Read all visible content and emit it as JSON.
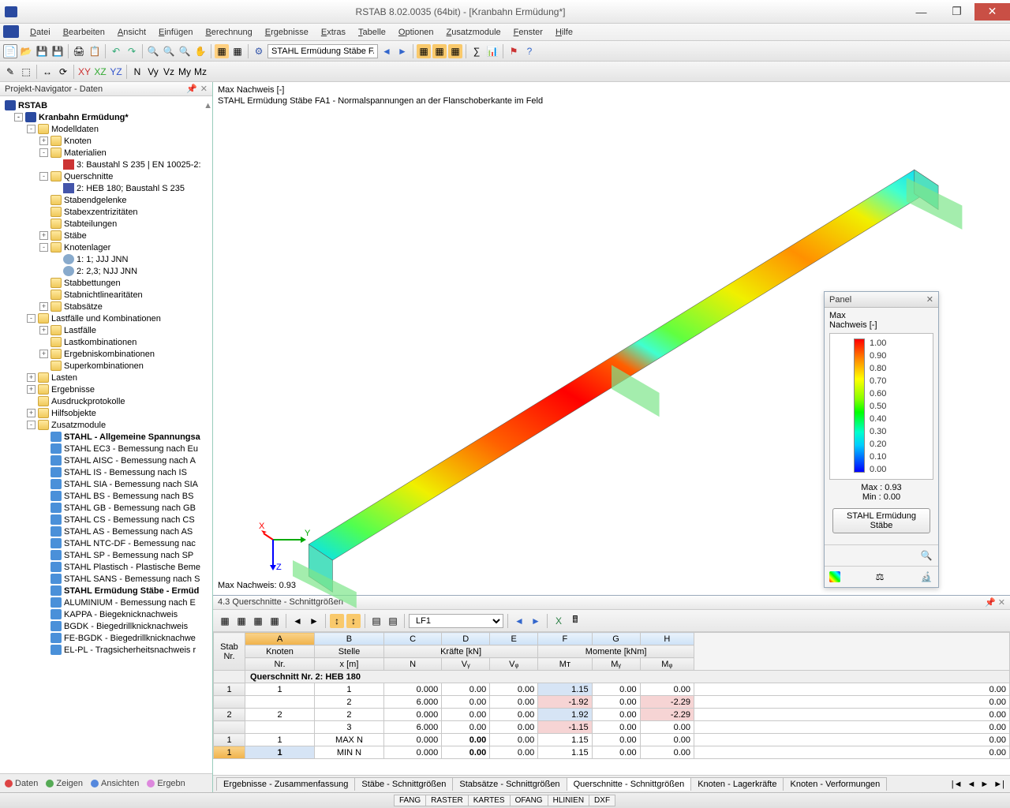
{
  "window": {
    "title": "RSTAB 8.02.0035 (64bit) - [Kranbahn Ermüdung*]",
    "min": "—",
    "max": "❐",
    "close": "✕"
  },
  "menu": [
    "Datei",
    "Bearbeiten",
    "Ansicht",
    "Einfügen",
    "Berechnung",
    "Ergebnisse",
    "Extras",
    "Tabelle",
    "Optionen",
    "Zusatzmodule",
    "Fenster",
    "Hilfe"
  ],
  "toolbar1_input": "STAHL Ermüdung Stäbe FA",
  "navigator": {
    "title": "Projekt-Navigator - Daten",
    "root": "RSTAB",
    "items": [
      {
        "lvl": 1,
        "exp": "-",
        "ico": "rstab",
        "label": "Kranbahn Ermüdung*",
        "bold": true
      },
      {
        "lvl": 2,
        "exp": "-",
        "ico": "folder-open",
        "label": "Modelldaten"
      },
      {
        "lvl": 3,
        "exp": "+",
        "ico": "folder",
        "label": "Knoten"
      },
      {
        "lvl": 3,
        "exp": "-",
        "ico": "folder-open",
        "label": "Materialien"
      },
      {
        "lvl": 4,
        "exp": "",
        "ico": "mat",
        "label": "3: Baustahl S 235 | EN 10025-2:"
      },
      {
        "lvl": 3,
        "exp": "-",
        "ico": "folder-open",
        "label": "Querschnitte"
      },
      {
        "lvl": 4,
        "exp": "",
        "ico": "cross",
        "label": "2: HEB 180; Baustahl S 235"
      },
      {
        "lvl": 3,
        "exp": "",
        "ico": "folder",
        "label": "Stabendgelenke"
      },
      {
        "lvl": 3,
        "exp": "",
        "ico": "folder",
        "label": "Stabexzentrizitäten"
      },
      {
        "lvl": 3,
        "exp": "",
        "ico": "folder",
        "label": "Stabteilungen"
      },
      {
        "lvl": 3,
        "exp": "+",
        "ico": "folder",
        "label": "Stäbe"
      },
      {
        "lvl": 3,
        "exp": "-",
        "ico": "folder-open",
        "label": "Knotenlager"
      },
      {
        "lvl": 4,
        "exp": "",
        "ico": "node",
        "label": "1: 1; JJJ JNN"
      },
      {
        "lvl": 4,
        "exp": "",
        "ico": "node",
        "label": "2: 2,3; NJJ JNN"
      },
      {
        "lvl": 3,
        "exp": "",
        "ico": "folder",
        "label": "Stabbettungen"
      },
      {
        "lvl": 3,
        "exp": "",
        "ico": "folder",
        "label": "Stabnichtlinearitäten"
      },
      {
        "lvl": 3,
        "exp": "+",
        "ico": "folder",
        "label": "Stabsätze"
      },
      {
        "lvl": 2,
        "exp": "-",
        "ico": "folder-open",
        "label": "Lastfälle und Kombinationen"
      },
      {
        "lvl": 3,
        "exp": "+",
        "ico": "folder",
        "label": "Lastfälle"
      },
      {
        "lvl": 3,
        "exp": "",
        "ico": "folder",
        "label": "Lastkombinationen"
      },
      {
        "lvl": 3,
        "exp": "+",
        "ico": "folder",
        "label": "Ergebniskombinationen"
      },
      {
        "lvl": 3,
        "exp": "",
        "ico": "folder",
        "label": "Superkombinationen"
      },
      {
        "lvl": 2,
        "exp": "+",
        "ico": "folder",
        "label": "Lasten"
      },
      {
        "lvl": 2,
        "exp": "+",
        "ico": "folder",
        "label": "Ergebnisse"
      },
      {
        "lvl": 2,
        "exp": "",
        "ico": "folder",
        "label": "Ausdruckprotokolle"
      },
      {
        "lvl": 2,
        "exp": "+",
        "ico": "folder",
        "label": "Hilfsobjekte"
      },
      {
        "lvl": 2,
        "exp": "-",
        "ico": "folder-open",
        "label": "Zusatzmodule"
      },
      {
        "lvl": 3,
        "exp": "",
        "ico": "module",
        "label": "STAHL - Allgemeine Spannungsa",
        "bold": true
      },
      {
        "lvl": 3,
        "exp": "",
        "ico": "module",
        "label": "STAHL EC3 - Bemessung nach Eu"
      },
      {
        "lvl": 3,
        "exp": "",
        "ico": "module",
        "label": "STAHL AISC - Bemessung nach A"
      },
      {
        "lvl": 3,
        "exp": "",
        "ico": "module",
        "label": "STAHL IS - Bemessung nach IS"
      },
      {
        "lvl": 3,
        "exp": "",
        "ico": "module",
        "label": "STAHL SIA - Bemessung nach SIA"
      },
      {
        "lvl": 3,
        "exp": "",
        "ico": "module",
        "label": "STAHL BS - Bemessung nach BS"
      },
      {
        "lvl": 3,
        "exp": "",
        "ico": "module",
        "label": "STAHL GB - Bemessung nach GB"
      },
      {
        "lvl": 3,
        "exp": "",
        "ico": "module",
        "label": "STAHL CS - Bemessung nach CS"
      },
      {
        "lvl": 3,
        "exp": "",
        "ico": "module",
        "label": "STAHL AS - Bemessung nach AS"
      },
      {
        "lvl": 3,
        "exp": "",
        "ico": "module",
        "label": "STAHL NTC-DF - Bemessung nac"
      },
      {
        "lvl": 3,
        "exp": "",
        "ico": "module",
        "label": "STAHL SP - Bemessung nach SP"
      },
      {
        "lvl": 3,
        "exp": "",
        "ico": "module",
        "label": "STAHL Plastisch - Plastische Beme"
      },
      {
        "lvl": 3,
        "exp": "",
        "ico": "module",
        "label": "STAHL SANS - Bemessung nach S"
      },
      {
        "lvl": 3,
        "exp": "",
        "ico": "module",
        "label": "STAHL Ermüdung Stäbe - Ermüd",
        "bold": true
      },
      {
        "lvl": 3,
        "exp": "",
        "ico": "module",
        "label": "ALUMINIUM - Bemessung nach E"
      },
      {
        "lvl": 3,
        "exp": "",
        "ico": "module",
        "label": "KAPPA - Biegeknicknachweis"
      },
      {
        "lvl": 3,
        "exp": "",
        "ico": "module",
        "label": "BGDK - Biegedrillknicknachweis"
      },
      {
        "lvl": 3,
        "exp": "",
        "ico": "module",
        "label": "FE-BGDK - Biegedrillknicknachwe"
      },
      {
        "lvl": 3,
        "exp": "",
        "ico": "module",
        "label": "EL-PL - Tragsicherheitsnachweis r"
      }
    ],
    "tabs": [
      {
        "label": "Daten",
        "color": "#d44"
      },
      {
        "label": "Zeigen",
        "color": "#5a5"
      },
      {
        "label": "Ansichten",
        "color": "#58d"
      },
      {
        "label": "Ergebn",
        "color": "#d8d"
      }
    ]
  },
  "viewport": {
    "line1": "Max Nachweis [-]",
    "line2": "STAHL Ermüdung Stäbe FA1 - Normalspannungen an der Flanschoberkante im Feld",
    "bottom": "Max Nachweis: 0.93"
  },
  "panel": {
    "title": "Panel",
    "l1": "Max",
    "l2": "Nachweis [-]",
    "ticks": [
      "1.00",
      "0.90",
      "0.80",
      "0.70",
      "0.60",
      "0.50",
      "0.40",
      "0.30",
      "0.20",
      "0.10",
      "0.00"
    ],
    "max_label": "Max :",
    "max_val": "0.93",
    "min_label": "Min :",
    "min_val": "0.00",
    "button": "STAHL Ermüdung Stäbe"
  },
  "table": {
    "title": "4.3 Querschnitte - Schnittgrößen",
    "lf": "LF1",
    "letters": [
      "A",
      "B",
      "C",
      "D",
      "E",
      "F",
      "G",
      "H"
    ],
    "h_stab": "Stab",
    "h_nr": "Nr.",
    "h_knoten": "Knoten",
    "h_knoten2": "Nr.",
    "h_stelle": "Stelle",
    "h_stelle2": "x [m]",
    "h_kraefte": "Kräfte [kN]",
    "h_momente": "Momente [kNm]",
    "h_N": "N",
    "h_Vy": "Vᵧ",
    "h_Vz": "Vᵩ",
    "h_MT": "Mᴛ",
    "h_My": "Mᵧ",
    "h_Mz": "Mᵩ",
    "section": "Querschnitt Nr. 2: HEB 180",
    "rows": [
      {
        "head": "1",
        "stab": "1",
        "kn": "1",
        "x": "0.000",
        "N": "0.00",
        "Vy": "0.00",
        "Vz": "1.15",
        "vzc": "hl-blue",
        "MT": "0.00",
        "My": "0.00",
        "Mz": "0.00"
      },
      {
        "head": "",
        "stab": "",
        "kn": "2",
        "x": "6.000",
        "N": "0.00",
        "Vy": "0.00",
        "Vz": "-1.92",
        "vzc": "hl-red",
        "MT": "0.00",
        "My": "-2.29",
        "myc": "hl-red",
        "Mz": "0.00"
      },
      {
        "head": "2",
        "stab": "2",
        "kn": "2",
        "x": "0.000",
        "N": "0.00",
        "Vy": "0.00",
        "Vz": "1.92",
        "vzc": "hl-blue",
        "MT": "0.00",
        "My": "-2.29",
        "myc": "hl-red",
        "Mz": "0.00"
      },
      {
        "head": "",
        "stab": "",
        "kn": "3",
        "x": "6.000",
        "N": "0.00",
        "Vy": "0.00",
        "Vz": "-1.15",
        "vzc": "hl-red",
        "MT": "0.00",
        "My": "0.00",
        "Mz": "0.00"
      },
      {
        "head": "1",
        "stab": "1",
        "kn": "MAX N",
        "x": "0.000",
        "N": "0.00",
        "nb": true,
        "Vy": "0.00",
        "Vz": "1.15",
        "MT": "0.00",
        "My": "0.00",
        "Mz": "0.00"
      },
      {
        "head": "1",
        "stab": "1",
        "kn": "MIN N",
        "x": "0.000",
        "N": "0.00",
        "nb": true,
        "Vy": "0.00",
        "Vz": "1.15",
        "MT": "0.00",
        "My": "0.00",
        "Mz": "0.00",
        "active": true
      }
    ],
    "tabs": [
      "Ergebnisse - Zusammenfassung",
      "Stäbe - Schnittgrößen",
      "Stabsätze - Schnittgrößen",
      "Querschnitte - Schnittgrößen",
      "Knoten - Lagerkräfte",
      "Knoten - Verformungen"
    ],
    "active_tab": 3
  },
  "status": [
    "FANG",
    "RASTER",
    "KARTES",
    "OFANG",
    "HLINIEN",
    "DXF"
  ],
  "chart_data": {
    "type": "colormap-legend",
    "title": "Max Nachweis [-]",
    "range": [
      0,
      1.0
    ],
    "ticks": [
      1.0,
      0.9,
      0.8,
      0.7,
      0.6,
      0.5,
      0.4,
      0.3,
      0.2,
      0.1,
      0.0
    ],
    "stats": {
      "max": 0.93,
      "min": 0.0
    },
    "palette": "rainbow (blue→cyan→green→yellow→orange→red)"
  }
}
